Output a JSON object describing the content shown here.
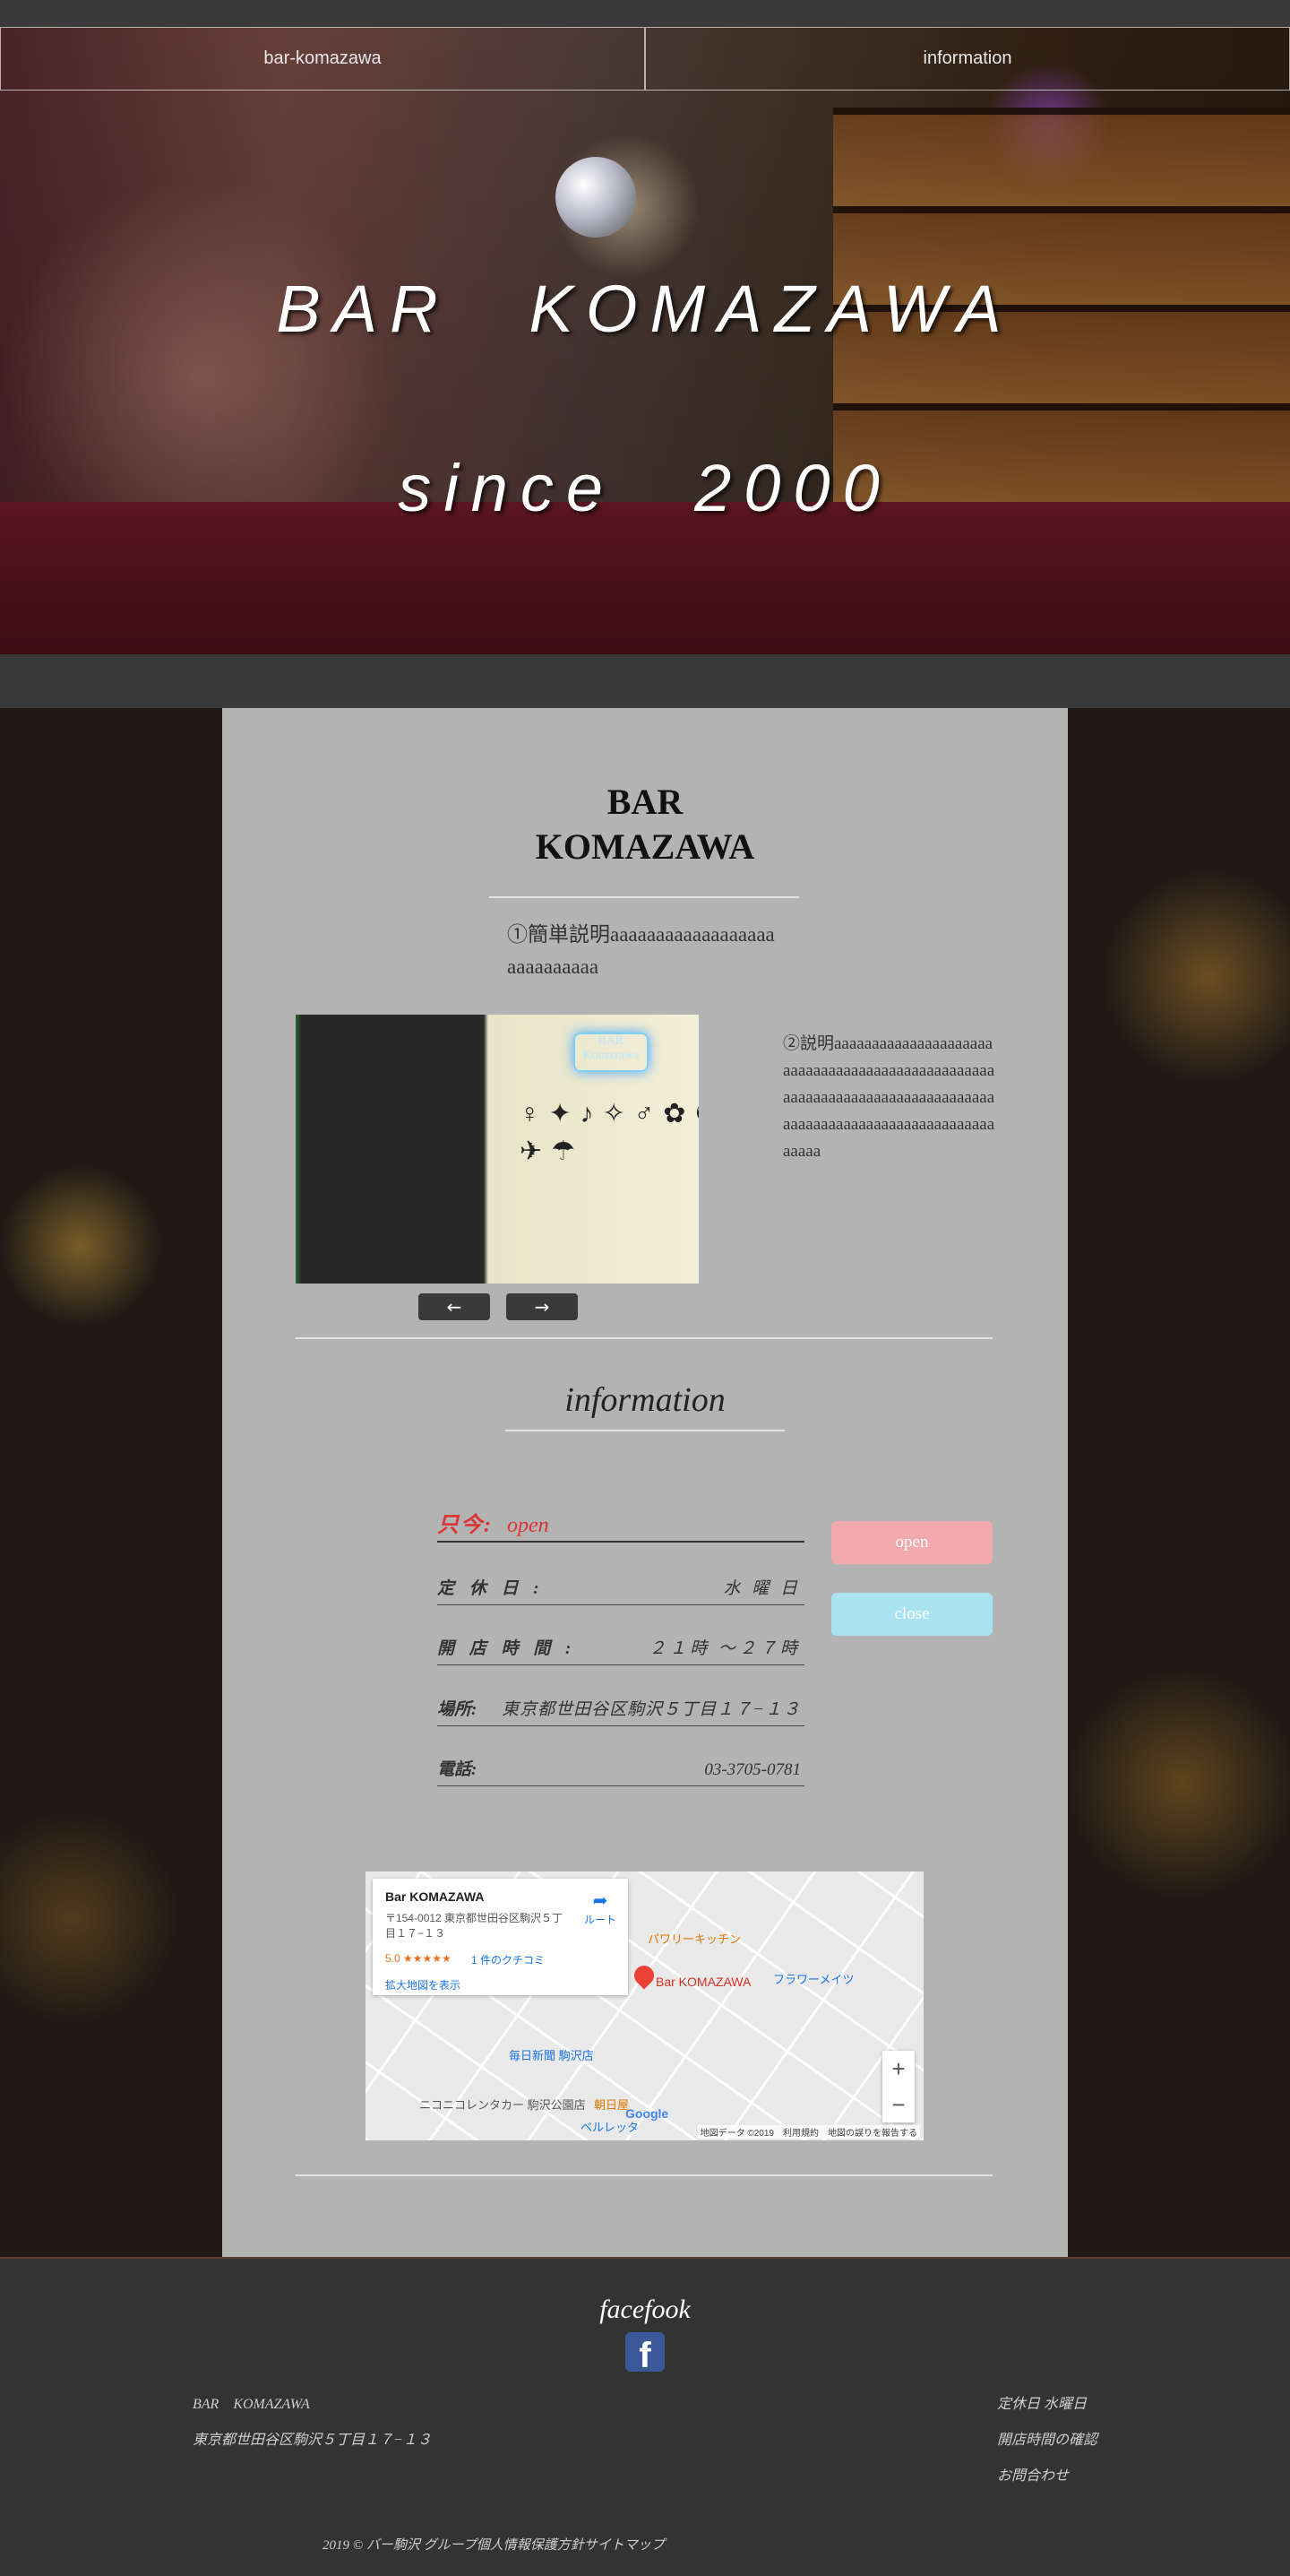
{
  "nav": {
    "items": [
      "bar-komazawa",
      "information"
    ]
  },
  "hero": {
    "title": "BAR　KOMAZAWA",
    "subtitle": "since　2000"
  },
  "about": {
    "title_line1": "BAR",
    "title_line2": "KOMAZAWA",
    "desc1": "①簡単説明aaaaaaaaaaaaaaaaaaaaaaaaaaaa",
    "desc2": "②説明aaaaaaaaaaaaaaaaaaaaaaaaaaaaaaaaaaaaaaaaaaaaaaaaaaaaaaaaaaaaaaaaaaaaaaaaaaaaaaaaaaaaaaaaaaaaaaaaaaaaaaaaaaaaaa",
    "prev_label": "←",
    "next_label": "→",
    "slide_neon_text": "BAR Komazawa"
  },
  "information": {
    "heading": "information",
    "now": {
      "label": "只今:",
      "value": "open"
    },
    "rows": [
      {
        "label": "定 休 日 :",
        "value": "水 曜 日"
      },
      {
        "label": "開 店 時 間 :",
        "value": "２１時 〜２７時"
      },
      {
        "label": "場所:",
        "value": "東京都世田谷区駒沢５丁目１７−１３"
      },
      {
        "label": "電話:",
        "value": "03-3705-0781"
      }
    ],
    "open_label": "open",
    "close_label": "close",
    "colors": {
      "open": "#f2a9ad",
      "close": "#a9e3f0",
      "now": "#d33333"
    }
  },
  "map": {
    "name": "Bar KOMAZAWA",
    "address": "〒154-0012 東京都世田谷区駒沢５丁目１７−１３",
    "rating": "5.0 ★★★★★",
    "reviews": "1 件のクチコミ",
    "enlarge": "拡大地図を表示",
    "route": "ルート",
    "pin_label": "Bar KOMAZAWA",
    "labels": [
      "パワリーキッチン",
      "フラワーメイツ",
      "毎日新聞 駒沢店",
      "ニコニコレンタカー 駒沢公園店",
      "朝日屋",
      "ベルレッタ"
    ],
    "zoom_in": "+",
    "zoom_out": "−",
    "google": "Google",
    "attribution": "地図データ ©2019　利用規約　地図の誤りを報告する"
  },
  "footer": {
    "facebook_title": "facefook",
    "facebook_icon": "facebook-icon",
    "name": "BAR　KOMAZAWA",
    "address": "東京都世田谷区駒沢５丁目１７−１３",
    "links": [
      "定休日 水曜日",
      "開店時間の確認",
      "お問合わせ"
    ],
    "copyright": "2019 © バー駒沢 グループ個人情報保護方針サイトマップ"
  }
}
